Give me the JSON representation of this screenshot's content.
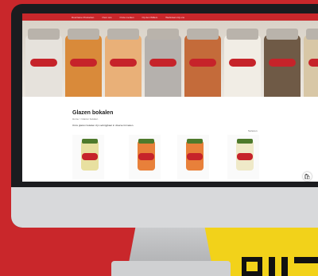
{
  "nav": {
    "items": [
      "Duurzame Producten",
      "Over ons",
      "Onze merken",
      "Op den Willem",
      "Werkzaam bij ons"
    ]
  },
  "category": {
    "title": "Glazen bokalen",
    "breadcrumb": "Home > Glazen bokalen",
    "description": "Onze glazen bokalen zijn verkrijgbaar in diverse formaten.",
    "sort_label": "Sorteren"
  },
  "products": [
    {
      "name": "jar-1",
      "lid": "#4e7a2c",
      "fill": "#e8e0a0"
    },
    {
      "name": "jar-2",
      "lid": "#4e7a2c",
      "fill": "#e8803a"
    },
    {
      "name": "jar-3",
      "lid": "#4e7a2c",
      "fill": "#e8803a"
    },
    {
      "name": "jar-4",
      "lid": "#4e7a2c",
      "fill": "#efe9c8"
    }
  ],
  "colors": {
    "brand": "#c9272b",
    "accent": "#f2d21a"
  },
  "icons": {
    "cart": "shopping-bag-icon"
  }
}
